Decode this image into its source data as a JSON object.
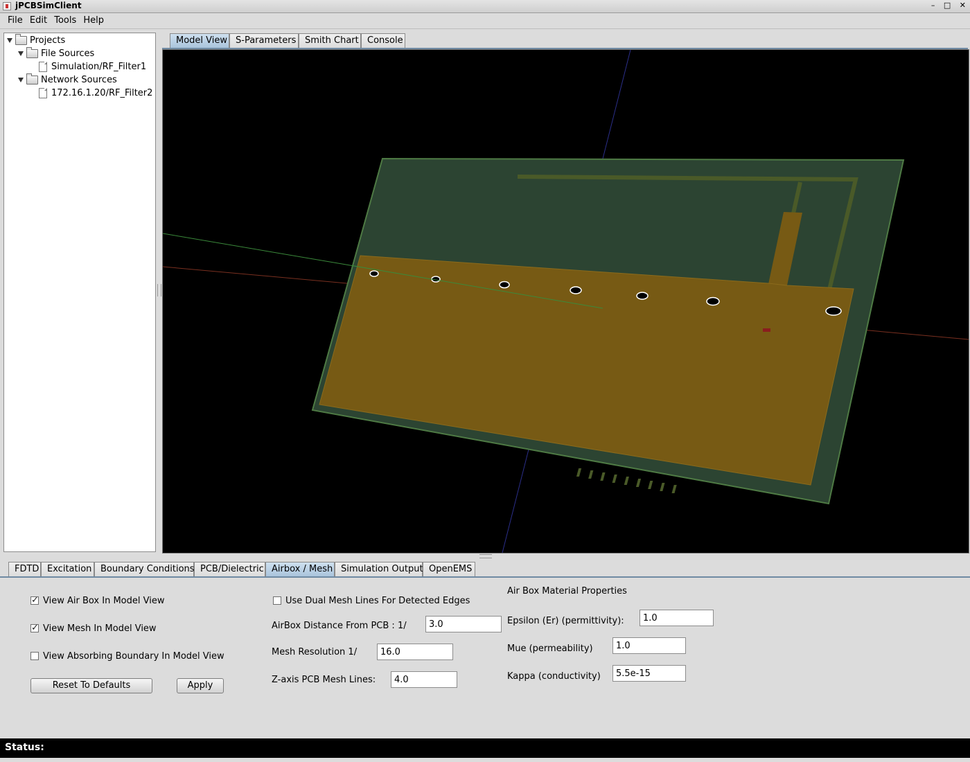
{
  "window": {
    "title": "jPCBSimClient",
    "controls": [
      "–",
      "□",
      "✕"
    ]
  },
  "menu": [
    "File",
    "Edit",
    "Tools",
    "Help"
  ],
  "tree": {
    "root": "Projects",
    "file_sources": "File Sources",
    "file_item": "Simulation/RF_Filter1",
    "network_sources": "Network Sources",
    "network_item": "172.16.1.20/RF_Filter2"
  },
  "view_tabs": [
    "Model View",
    "S-Parameters",
    "Smith Chart",
    "Console"
  ],
  "settings_tabs": [
    "FDTD",
    "Excitation",
    "Boundary Conditions",
    "PCB/Dielectric",
    "Airbox / Mesh",
    "Simulation Output",
    "OpenEMS"
  ],
  "airbox": {
    "view_air_box": {
      "label": "View Air Box In Model View",
      "checked": true
    },
    "view_mesh": {
      "label": "View Mesh In Model View",
      "checked": true
    },
    "view_absorbing": {
      "label": "View Absorbing Boundary In Model View",
      "checked": false
    },
    "reset_label": "Reset To Defaults",
    "apply_label": "Apply",
    "dual_mesh": {
      "label": "Use Dual Mesh Lines For Detected Edges",
      "checked": false
    },
    "distance_label": "AirBox Distance From PCB : 1/",
    "distance_value": "3.0",
    "mesh_res_label": "Mesh Resolution  1/",
    "mesh_res_value": "16.0",
    "zaxis_label": "Z-axis PCB Mesh Lines:",
    "zaxis_value": "4.0"
  },
  "material": {
    "heading": "Air Box Material Properties",
    "epsilon_label": "Epsilon (Er) (permittivity):",
    "epsilon_value": "1.0",
    "mue_label": "Mue  (permeability)",
    "mue_value": "1.0",
    "kappa_label": "Kappa (conductivity)",
    "kappa_value": "5.5e-15"
  },
  "status": {
    "label": "Status:"
  },
  "colors": {
    "board": "#2c4432",
    "copper": "#775a14",
    "axis_x": "#7a3020",
    "axis_y": "#3b8a3b",
    "axis_z": "#2b2f8a"
  }
}
